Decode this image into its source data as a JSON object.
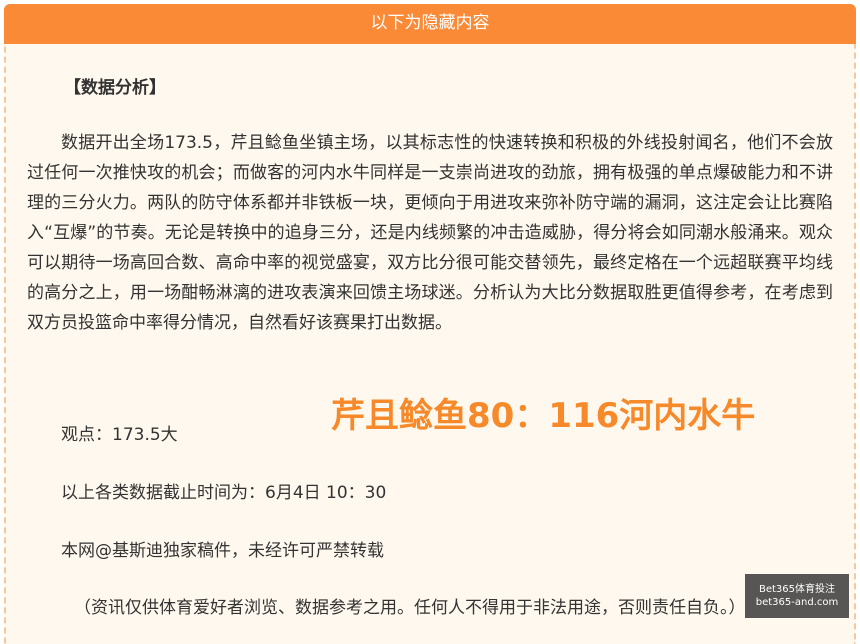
{
  "header": {
    "title": "以下为隐藏内容"
  },
  "article": {
    "heading": "【数据分析】",
    "body": "数据开出全场173.5，芹且鲶鱼坐镇主场，以其标志性的快速转换和积极的外线投射闻名，他们不会放过任何一次推快攻的机会；而做客的河内水牛同样是一支崇尚进攻的劲旅，拥有极强的单点爆破能力和不讲理的三分火力。两队的防守体系都并非铁板一块，更倾向于用进攻来弥补防守端的漏洞，这注定会让比赛陷入“互爆”的节奏。无论是转换中的追身三分，还是内线频繁的冲击造威胁，得分将会如同潮水般涌来。观众可以期待一场高回合数、高命中率的视觉盛宴，双方比分很可能交替领先，最终定格在一个远超联赛平均线的高分之上，用一场酣畅淋漓的进攻表演来回馈主场球迷。分析认为大比分数据取胜更值得参考，在考虑到双方员投篮命中率得分情况，自然看好该赛果打出数据。",
    "scoreline": "芹且鲶鱼80：116河内水牛",
    "viewpoint": "观点：173.5大",
    "cutoff": "以上各类数据截止时间为：6月4日 10：30",
    "copyright": "本网@基斯迪独家稿件，未经许可严禁转载",
    "disclaimer": "（资讯仅供体育爱好者浏览、数据参考之用。任何人不得用于非法用途，否则责任自负。）"
  },
  "watermark": {
    "line1": "Bet365体育投注",
    "line2": "bet365-and.com"
  },
  "colors": {
    "header_bg": "#fb8a37",
    "panel_bg": "#fff8ee",
    "border": "#f4c89c",
    "score_text": "#f68a2a",
    "body_text": "#333333"
  }
}
